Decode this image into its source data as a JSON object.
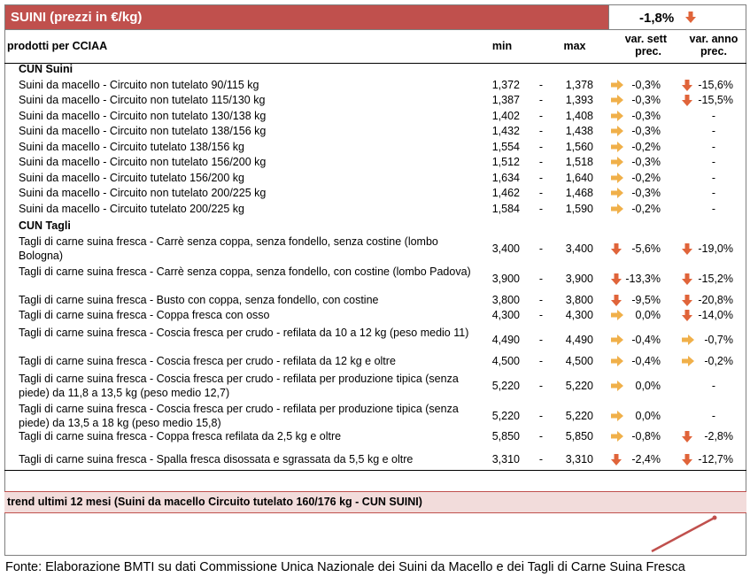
{
  "header": {
    "title": "SUINI (prezzi in €/kg)",
    "overall_change": "-1,8%",
    "overall_trend_icon": "arrow-down-icon",
    "accent_color": "#c0504d"
  },
  "columns": {
    "product": "prodotti per CCIAA",
    "min": "min",
    "max": "max",
    "var_week_line1": "var. sett",
    "var_week_line2": "prec.",
    "var_year_line1": "var. anno",
    "var_year_line2": "prec."
  },
  "sections": [
    {
      "title": "CUN Suini"
    },
    {
      "title": "CUN Tagli"
    }
  ],
  "rows": [
    {
      "name": "Suini da macello - Circuito non tutelato 90/115 kg",
      "min": "1,372",
      "dash": "-",
      "max": "1,378",
      "vs_icon": "arrow-right-icon",
      "vs": "-0,3%",
      "va_icon": "arrow-down-icon",
      "va": "-15,6%"
    },
    {
      "name": "Suini da macello - Circuito non tutelato 115/130 kg",
      "min": "1,387",
      "dash": "-",
      "max": "1,393",
      "vs_icon": "arrow-right-icon",
      "vs": "-0,3%",
      "va_icon": "arrow-down-icon",
      "va": "-15,5%"
    },
    {
      "name": "Suini da macello - Circuito non tutelato 130/138 kg",
      "min": "1,402",
      "dash": "-",
      "max": "1,408",
      "vs_icon": "arrow-right-icon",
      "vs": "-0,3%",
      "va_icon": "",
      "va": "-"
    },
    {
      "name": "Suini da macello - Circuito non tutelato 138/156 kg",
      "min": "1,432",
      "dash": "-",
      "max": "1,438",
      "vs_icon": "arrow-right-icon",
      "vs": "-0,3%",
      "va_icon": "",
      "va": "-"
    },
    {
      "name": "Suini da macello - Circuito tutelato 138/156 kg",
      "min": "1,554",
      "dash": "-",
      "max": "1,560",
      "vs_icon": "arrow-right-icon",
      "vs": "-0,2%",
      "va_icon": "",
      "va": "-"
    },
    {
      "name": "Suini da macello - Circuito non tutelato 156/200 kg",
      "min": "1,512",
      "dash": "-",
      "max": "1,518",
      "vs_icon": "arrow-right-icon",
      "vs": "-0,3%",
      "va_icon": "",
      "va": "-"
    },
    {
      "name": "Suini da macello - Circuito tutelato 156/200 kg",
      "min": "1,634",
      "dash": "-",
      "max": "1,640",
      "vs_icon": "arrow-right-icon",
      "vs": "-0,2%",
      "va_icon": "",
      "va": "-"
    },
    {
      "name": "Suini da macello - Circuito non tutelato 200/225 kg",
      "min": "1,462",
      "dash": "-",
      "max": "1,468",
      "vs_icon": "arrow-right-icon",
      "vs": "-0,3%",
      "va_icon": "",
      "va": "-"
    },
    {
      "name": "Suini da macello - Circuito tutelato 200/225 kg",
      "min": "1,584",
      "dash": "-",
      "max": "1,590",
      "vs_icon": "arrow-right-icon",
      "vs": "-0,2%",
      "va_icon": "",
      "va": "-"
    },
    {
      "name": "Tagli di carne suina fresca - Carrè senza coppa, senza fondello, senza costine (lombo Bologna)",
      "min": "3,400",
      "dash": "-",
      "max": "3,400",
      "vs_icon": "arrow-down-icon",
      "vs": "-5,6%",
      "va_icon": "arrow-down-icon",
      "va": "-19,0%"
    },
    {
      "name": "Tagli di carne suina fresca - Carrè senza coppa, senza fondello, con costine (lombo Padova)",
      "min": "3,900",
      "dash": "-",
      "max": "3,900",
      "vs_icon": "arrow-down-icon",
      "vs": "-13,3%",
      "va_icon": "arrow-down-icon",
      "va": "-15,2%"
    },
    {
      "name": "Tagli di carne suina fresca - Busto con coppa, senza fondello, con costine",
      "min": "3,800",
      "dash": "-",
      "max": "3,800",
      "vs_icon": "arrow-down-icon",
      "vs": "-9,5%",
      "va_icon": "arrow-down-icon",
      "va": "-20,8%"
    },
    {
      "name": "Tagli di carne suina fresca - Coppa fresca con osso",
      "min": "4,300",
      "dash": "-",
      "max": "4,300",
      "vs_icon": "arrow-right-icon",
      "vs": "0,0%",
      "va_icon": "arrow-down-icon",
      "va": "-14,0%"
    },
    {
      "name": "Tagli di carne suina fresca - Coscia fresca per crudo - refilata da 10 a 12 kg (peso medio 11)",
      "min": "4,490",
      "dash": "-",
      "max": "4,490",
      "vs_icon": "arrow-right-icon",
      "vs": "-0,4%",
      "va_icon": "arrow-right-icon",
      "va": "-0,7%"
    },
    {
      "name": "Tagli di carne suina fresca - Coscia fresca per crudo - refilata da 12 kg e oltre",
      "min": "4,500",
      "dash": "-",
      "max": "4,500",
      "vs_icon": "arrow-right-icon",
      "vs": "-0,4%",
      "va_icon": "arrow-right-icon",
      "va": "-0,2%"
    },
    {
      "name": "Tagli di carne suina fresca - Coscia fresca per crudo - refilata per produzione tipica (senza piede) da 11,8 a 13,5 kg (peso medio 12,7)",
      "min": "5,220",
      "dash": "-",
      "max": "5,220",
      "vs_icon": "arrow-right-icon",
      "vs": "0,0%",
      "va_icon": "",
      "va": "-"
    },
    {
      "name": "Tagli di carne suina fresca - Coscia fresca per crudo - refilata per produzione tipica (senza piede) da 13,5 a 18 kg (peso medio 15,8)",
      "min": "5,220",
      "dash": "-",
      "max": "5,220",
      "vs_icon": "arrow-right-icon",
      "vs": "0,0%",
      "va_icon": "",
      "va": "-"
    },
    {
      "name": "Tagli di carne suina fresca - Coppa fresca refilata da 2,5 kg e oltre",
      "min": "5,850",
      "dash": "-",
      "max": "5,850",
      "vs_icon": "arrow-right-icon",
      "vs": "-0,8%",
      "va_icon": "arrow-down-icon",
      "va": "-2,8%"
    },
    {
      "name": "Tagli di carne suina fresca - Spalla fresca disossata e sgrassata da 5,5 kg e oltre",
      "min": "3,310",
      "dash": "-",
      "max": "3,310",
      "vs_icon": "arrow-down-icon",
      "vs": "-2,4%",
      "va_icon": "arrow-down-icon",
      "va": "-12,7%"
    }
  ],
  "trend": {
    "label": "trend ultimi 12 mesi (Suini da macello Circuito tutelato 160/176 kg - CUN SUINI)",
    "line_color": "#c0504d"
  },
  "footer": {
    "source": "Fonte: Elaborazione BMTI su dati Commissione Unica Nazionale dei Suini da Macello e dei Tagli di Carne Suina Fresca"
  },
  "icon_colors": {
    "arrow-down-icon": "#e0643a",
    "arrow-right-icon": "#f0b04a"
  }
}
